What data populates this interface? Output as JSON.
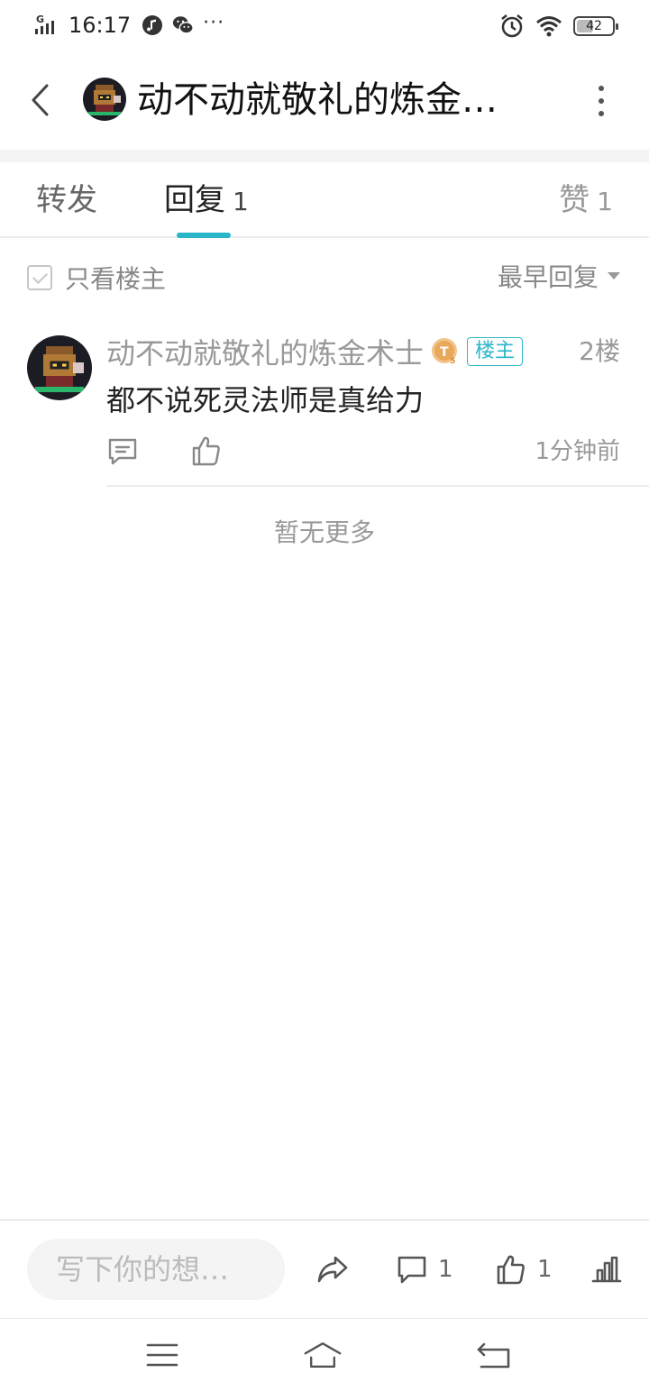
{
  "status_bar": {
    "time": "16:17",
    "network": "G",
    "battery": "42",
    "more": "···"
  },
  "header": {
    "title": "动不动就敬礼的炼金…"
  },
  "tabs": {
    "forward_label": "转发",
    "reply_label": "回复",
    "reply_count": "1",
    "like_label": "赞",
    "like_count": "1"
  },
  "filter": {
    "only_op_label": "只看楼主",
    "sort_label": "最早回复"
  },
  "reply": {
    "author": "动不动就敬礼的炼金术士",
    "level_badge": "T5",
    "op_badge": "楼主",
    "floor": "2楼",
    "content": "都不说死灵法师是真给力",
    "time": "1分钟前"
  },
  "no_more": "暂无更多",
  "action_bar": {
    "input_placeholder": "写下你的想…",
    "comment_count": "1",
    "like_count": "1"
  },
  "colors": {
    "accent": "#2bb5c8",
    "muted_text": "#999999",
    "divider": "#ececec"
  }
}
